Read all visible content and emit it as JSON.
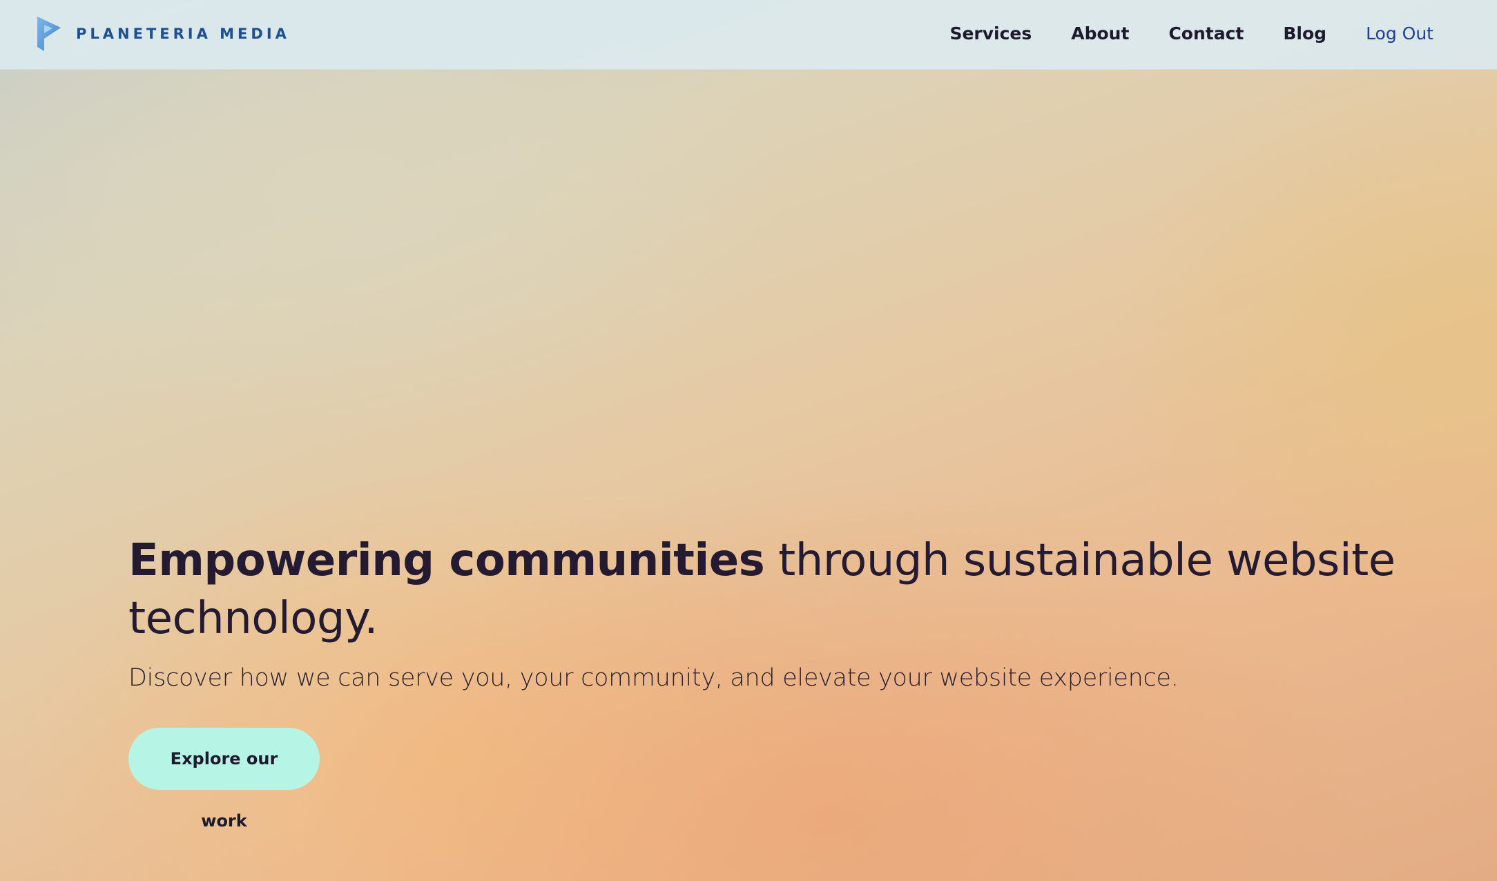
{
  "header": {
    "brand": "PLANETERIA MEDIA",
    "nav": [
      {
        "label": "Services"
      },
      {
        "label": "About"
      },
      {
        "label": "Contact"
      },
      {
        "label": "Blog"
      },
      {
        "label": "Log Out"
      }
    ]
  },
  "hero": {
    "headline_strong": "Empowering communities",
    "headline_rest": " through sustainable website technology.",
    "subheadline": "Discover how we can serve you, your community, and elevate your website experience.",
    "cta_label": "Explore our work"
  },
  "colors": {
    "brand_blue": "#1d4f91",
    "link_blue": "#1f3f9c",
    "cta_bg": "#b6f5e6",
    "text_dark": "#241a32"
  }
}
